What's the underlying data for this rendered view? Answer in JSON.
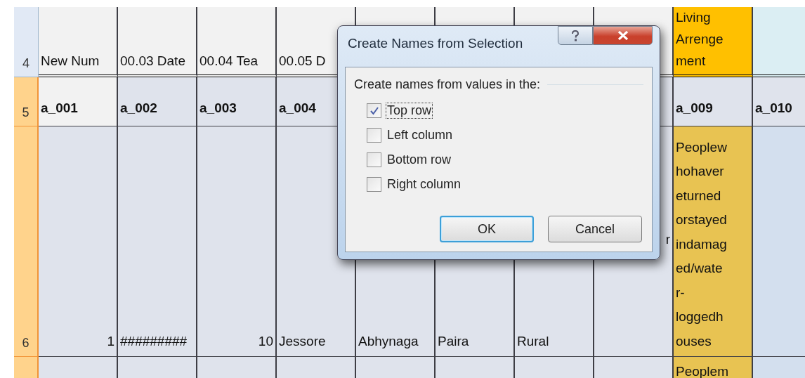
{
  "sheet": {
    "rows": [
      {
        "header": "4",
        "selected": false,
        "cells": [
          {
            "kind": "text",
            "lines": [
              "New Num"
            ]
          },
          {
            "kind": "text",
            "lines": [
              "00.03 Date"
            ]
          },
          {
            "kind": "text",
            "lines": [
              "00.04 Tea"
            ]
          },
          {
            "kind": "text",
            "lines": [
              "00.05 D"
            ]
          },
          {},
          {},
          {},
          {},
          {
            "kind": "text",
            "lines": [
              "Living",
              "Arrenge",
              "ment"
            ]
          },
          {}
        ]
      },
      {
        "header": "5",
        "selected": true,
        "cells": [
          {
            "kind": "bold",
            "lines": [
              "a_001"
            ]
          },
          {
            "kind": "bold",
            "lines": [
              "a_002"
            ]
          },
          {
            "kind": "bold",
            "lines": [
              "a_003"
            ]
          },
          {
            "kind": "bold",
            "lines": [
              "a_004"
            ]
          },
          {
            "covered": true
          },
          {
            "covered": true
          },
          {
            "covered": true
          },
          {},
          {
            "kind": "bold",
            "lines": [
              "a_009"
            ]
          },
          {
            "kind": "bold",
            "lines": [
              "a_010"
            ]
          }
        ]
      },
      {
        "header": "6",
        "selected": true,
        "cells": [
          {
            "kind": "number",
            "lines": [
              "1"
            ]
          },
          {
            "kind": "text",
            "lines": [
              "#########"
            ]
          },
          {
            "kind": "number",
            "lines": [
              "10"
            ]
          },
          {
            "kind": "text",
            "lines": [
              "Jessore"
            ]
          },
          {
            "kind": "text",
            "lines": [
              "Abhynaga"
            ]
          },
          {
            "kind": "text",
            "lines": [
              "Paira"
            ]
          },
          {
            "kind": "text",
            "lines": [
              "Rural"
            ]
          },
          {
            "kind": "middle",
            "lines": [
              "r"
            ]
          },
          {
            "kind": "text",
            "lines": [
              "Peoplew",
              "hohaver",
              "eturned",
              "orstayed",
              "indamag",
              "ed/wate",
              "r-",
              "loggedh",
              "ouses"
            ]
          },
          {}
        ]
      },
      {
        "header": "",
        "selected": true,
        "cells": [
          {},
          {},
          {},
          {},
          {},
          {},
          {},
          {},
          {
            "kind": "top",
            "lines": [
              "Peoplem"
            ]
          },
          {}
        ]
      }
    ]
  },
  "dialog": {
    "title": "Create Names from Selection",
    "group_label": "Create names from values in the:",
    "options": [
      {
        "label": "Top row",
        "checked": true,
        "focused": true
      },
      {
        "label": "Left column",
        "checked": false,
        "focused": false
      },
      {
        "label": "Bottom row",
        "checked": false,
        "focused": false
      },
      {
        "label": "Right column",
        "checked": false,
        "focused": false
      }
    ],
    "buttons": [
      {
        "label": "OK",
        "default": true
      },
      {
        "label": "Cancel",
        "default": false
      }
    ]
  }
}
